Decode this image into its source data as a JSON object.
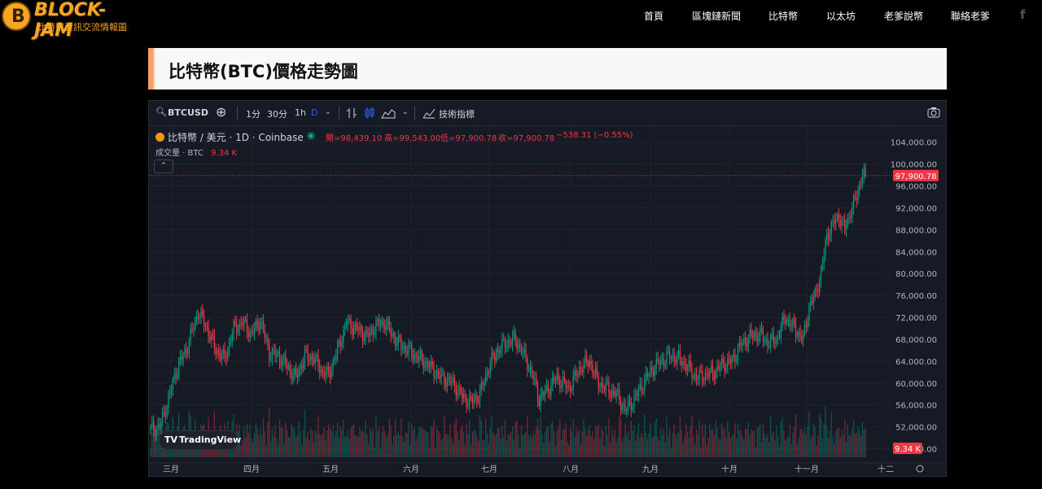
{
  "nav": {
    "logo_title": "BLOCK-JAM",
    "logo_subtitle": "比特幣資訊交流情報圖",
    "items": [
      "首頁",
      "區塊鏈新聞",
      "比特幣",
      "以太坊",
      "老爹說幣",
      "聯絡老爹"
    ],
    "social_icon": "facebook-icon"
  },
  "page": {
    "title": "比特幣(BTC)價格走勢圖"
  },
  "widget": {
    "toolbar": {
      "symbol": "BTCUSD",
      "intervals": [
        "1分",
        "30分",
        "1h",
        "D"
      ],
      "active_interval": "D",
      "indicators_label": "技術指標"
    },
    "legend": {
      "title": "比特幣 / 美元 · 1D · Coinbase",
      "open": "開=98,439.10",
      "high": "高=99,543.00",
      "low": "低=97,900.78",
      "close": "收=97,900.78",
      "change": "−538.31 (−0.55%)",
      "volume_label": "成交量 · BTC",
      "volume_value": "9.34 K"
    },
    "price_tag": "97,900.78",
    "volume_tag": "9.34 K",
    "brand": "TradingView",
    "colors": {
      "up": "#089981",
      "down": "#f23645",
      "background": "#161a25",
      "accent": "#2962ff"
    }
  },
  "chart_data": {
    "type": "candlestick",
    "title": "比特幣 / 美元 · 1D · Coinbase",
    "x_tick_labels": [
      "三月",
      "四月",
      "五月",
      "六月",
      "七月",
      "八月",
      "九月",
      "十月",
      "十一月",
      "十二"
    ],
    "y_tick_labels": [
      "104,000.00",
      "100,000.00",
      "96,000.00",
      "92,000.00",
      "88,000.00",
      "84,000.00",
      "80,000.00",
      "76,000.00",
      "72,000.00",
      "68,000.00",
      "64,000.00",
      "60,000.00",
      "56,000.00",
      "52,000.00",
      "48,000.00"
    ],
    "ylim": [
      46000,
      105000
    ],
    "last_price": 97900.78,
    "close_anchors": [
      [
        0,
        51500
      ],
      [
        6,
        52000
      ],
      [
        12,
        57000
      ],
      [
        18,
        63000
      ],
      [
        24,
        66000
      ],
      [
        32,
        73000
      ],
      [
        38,
        70000
      ],
      [
        44,
        66000
      ],
      [
        50,
        64500
      ],
      [
        56,
        70000
      ],
      [
        62,
        71000
      ],
      [
        68,
        69000
      ],
      [
        74,
        71500
      ],
      [
        80,
        65500
      ],
      [
        86,
        65000
      ],
      [
        92,
        63000
      ],
      [
        98,
        61000
      ],
      [
        104,
        65000
      ],
      [
        110,
        64500
      ],
      [
        116,
        62000
      ],
      [
        120,
        61500
      ],
      [
        126,
        66000
      ],
      [
        132,
        71000
      ],
      [
        138,
        70000
      ],
      [
        146,
        68500
      ],
      [
        152,
        70500
      ],
      [
        158,
        71000
      ],
      [
        166,
        67500
      ],
      [
        176,
        65500
      ],
      [
        184,
        64000
      ],
      [
        190,
        62500
      ],
      [
        196,
        61000
      ],
      [
        204,
        60000
      ],
      [
        210,
        57500
      ],
      [
        216,
        56500
      ],
      [
        222,
        58000
      ],
      [
        228,
        63000
      ],
      [
        234,
        66000
      ],
      [
        240,
        67500
      ],
      [
        246,
        68000
      ],
      [
        252,
        65000
      ],
      [
        258,
        61000
      ],
      [
        262,
        57000
      ],
      [
        268,
        59000
      ],
      [
        274,
        61000
      ],
      [
        282,
        59000
      ],
      [
        290,
        63000
      ],
      [
        296,
        64000
      ],
      [
        302,
        60000
      ],
      [
        308,
        59000
      ],
      [
        314,
        58000
      ],
      [
        320,
        55000
      ],
      [
        326,
        57000
      ],
      [
        332,
        60000
      ],
      [
        338,
        62500
      ],
      [
        344,
        64000
      ],
      [
        350,
        65000
      ],
      [
        356,
        64500
      ],
      [
        362,
        63000
      ],
      [
        368,
        61000
      ],
      [
        374,
        61500
      ],
      [
        380,
        62000
      ],
      [
        386,
        63500
      ],
      [
        392,
        64000
      ],
      [
        398,
        67000
      ],
      [
        404,
        68500
      ],
      [
        410,
        69000
      ],
      [
        416,
        67500
      ],
      [
        422,
        68000
      ],
      [
        428,
        72000
      ],
      [
        434,
        70000
      ],
      [
        440,
        68000
      ],
      [
        444,
        74000
      ],
      [
        448,
        76000
      ],
      [
        452,
        80000
      ],
      [
        456,
        87000
      ],
      [
        460,
        89000
      ],
      [
        464,
        90500
      ],
      [
        468,
        88000
      ],
      [
        472,
        91500
      ],
      [
        476,
        94000
      ],
      [
        480,
        98500
      ],
      [
        482,
        97900.78
      ]
    ],
    "volume_unit": "BTC",
    "last_volume_k": 9.34
  }
}
